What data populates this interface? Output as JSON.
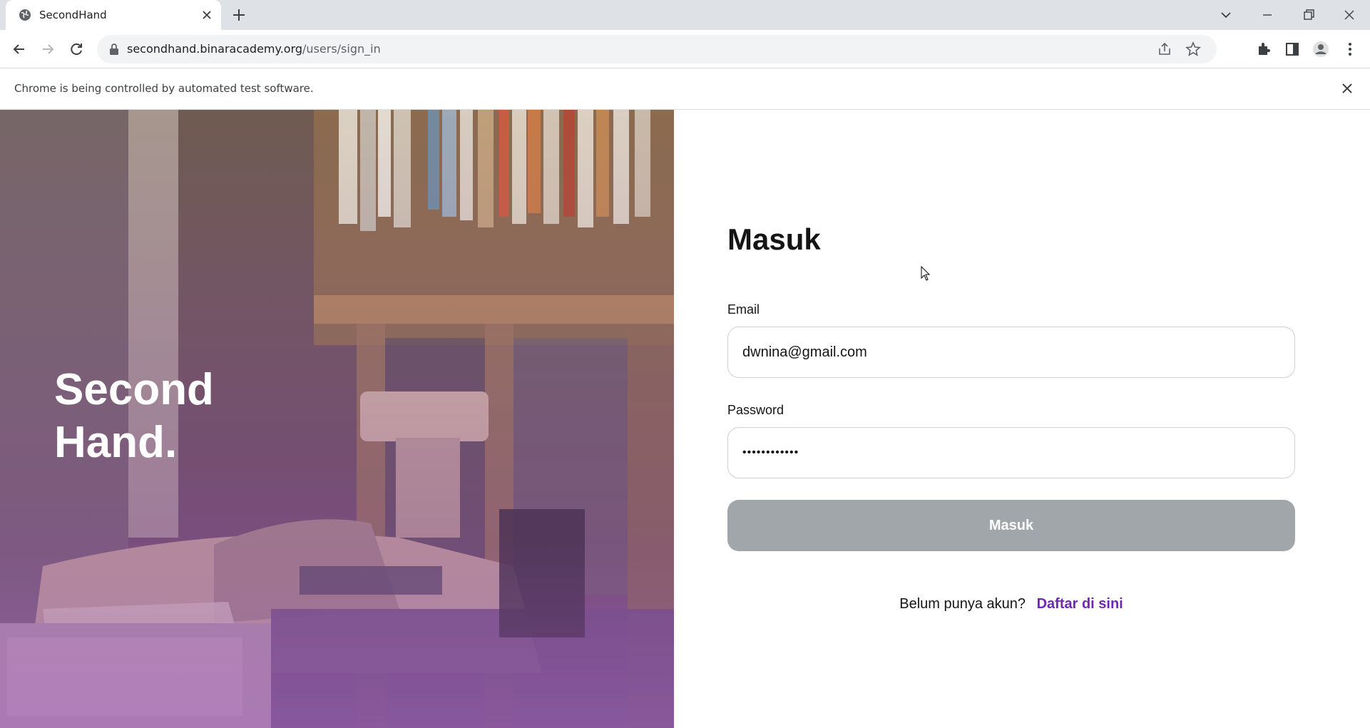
{
  "browser": {
    "tab_title": "SecondHand",
    "url_host": "secondhand.binaracademy.org",
    "url_path": "/users/sign_in",
    "infobar_text": "Chrome is being controlled by automated test software."
  },
  "hero": {
    "title": "Second\nHand."
  },
  "form": {
    "title": "Masuk",
    "email_label": "Email",
    "email_value": "dwnina@gmail.com",
    "password_label": "Password",
    "password_value": "••••••••••••",
    "submit_label": "Masuk",
    "register_prompt": "Belum punya akun?",
    "register_link": "Daftar di sini"
  },
  "colors": {
    "accent": "#7126b5",
    "button_disabled": "#a0a6aa"
  }
}
